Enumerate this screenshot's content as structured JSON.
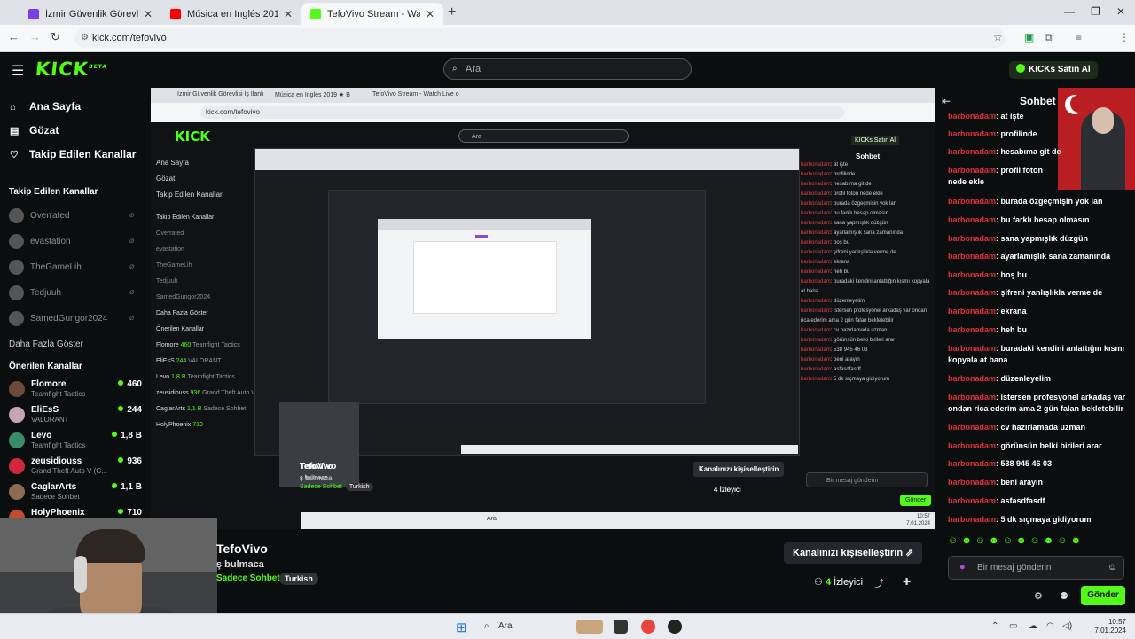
{
  "browser": {
    "tabs": [
      {
        "title": "İzmir Güvenlik Görevlisi İş İlanlı",
        "favicon_color": "#7b3fe4"
      },
      {
        "title": "Música en Inglés 2019 ★ B",
        "favicon_color": "#ff0000"
      },
      {
        "title": "TefoVivo Stream - Watch Live o",
        "favicon_color": "#53fc18"
      }
    ],
    "new_tab": "+",
    "url": "kick.com/tefovivo"
  },
  "header": {
    "logo": "KICK",
    "logo_tag": "BETA",
    "search_placeholder": "Ara",
    "buy_kicks": "KICKs Satın Al"
  },
  "sidebar": {
    "nav": [
      {
        "label": "Ana Sayfa",
        "icon": "home-icon"
      },
      {
        "label": "Gözat",
        "icon": "browse-icon"
      },
      {
        "label": "Takip Edilen Kanallar",
        "icon": "heart-icon"
      }
    ],
    "followed_heading": "Takip Edilen Kanallar",
    "followed": [
      "Overrated",
      "evastation",
      "TheGameLih",
      "Tedjuuh",
      "SamedGungor2024"
    ],
    "show_more": "Daha Fazla Göster",
    "recommended_heading": "Önerilen Kanallar",
    "recommended": [
      {
        "name": "Flomore",
        "game": "Teamfight Tactics",
        "viewers": "460",
        "color": "#6b4a3a"
      },
      {
        "name": "EliEsS",
        "game": "VALORANT",
        "viewers": "244",
        "color": "#c7a3b5"
      },
      {
        "name": "Levo",
        "game": "Teamfight Tactics",
        "viewers": "1,8 B",
        "color": "#3a8a6b"
      },
      {
        "name": "zeusidiouss",
        "game": "Grand Theft Auto V (G...",
        "viewers": "936",
        "color": "#d0283a"
      },
      {
        "name": "CaglarArts",
        "game": "Sadece Sohbet",
        "viewers": "1,1 B",
        "color": "#8d6b52"
      },
      {
        "name": "HolyPhoenix",
        "game": "",
        "viewers": "710",
        "color": "#c14d2a"
      }
    ]
  },
  "nested": {
    "url": "kick.com/tefovivo",
    "tab1": "İzmir Güvenlik Görevlisi İş İlanlı",
    "tab2": "Música en Inglés 2019 ★ B",
    "tab3": "TefoVivo Stream - Watch Live o",
    "search": "Ara",
    "logo": "KICK",
    "nav1": "Ana Sayfa",
    "nav2": "Gözat",
    "nav3": "Takip Edilen Kanallar",
    "followed_heading": "Takip Edilen Kanallar",
    "followed": [
      "Overrated",
      "evastation",
      "TheGameLih",
      "Tedjuuh",
      "SamedGungor2024"
    ],
    "show_more": "Daha Fazla Göster",
    "recommended_heading": "Önerilen Kanallar",
    "recommended": [
      {
        "name": "Flomore",
        "game": "Teamfight Tactics",
        "viewers": "460"
      },
      {
        "name": "EliEsS",
        "game": "VALORANT",
        "viewers": "244"
      },
      {
        "name": "Levo",
        "game": "Teamfight Tactics",
        "viewers": "1,8 B"
      },
      {
        "name": "zeusidiouss",
        "game": "Grand Theft Auto V (G...",
        "viewers": "936"
      },
      {
        "name": "CaglarArts",
        "game": "Sadece Sohbet",
        "viewers": "1,1 B"
      },
      {
        "name": "HolyPhoenix",
        "game": "",
        "viewers": "710"
      }
    ],
    "chat_title": "Sohbet",
    "buy_kicks": "KICKs Satın Al",
    "streamer": "TefoVivo",
    "title": "ş bulmaca",
    "category": "Sadece Sohbet",
    "language": "Turkish",
    "customize": "Kanalınızı kişiselleştirin",
    "viewers": "4 İzleyici",
    "chat_placeholder": "Bir mesaj gönderin",
    "send": "Gönder",
    "clock_time": "10:57",
    "clock_date": "7.01.2024"
  },
  "stream_info": {
    "streamer": "TefoVivo",
    "title": "ş bulmaca",
    "category": "Sadece Sohbet",
    "language": "Turkish",
    "customize": "Kanalınızı kişiselleştirin",
    "viewers_count": "4",
    "viewers_label": "İzleyici"
  },
  "chat": {
    "title": "Sohbet",
    "username": "barbonadam",
    "messages": [
      "at işte",
      "profilinde",
      "hesabıma git de",
      "profil foton nede ekle",
      "burada özgeçmişin yok lan",
      "bu farklı hesap olmasın",
      "sana yapmışlık düzgün",
      "ayarlamışlık sana zamanında",
      "boş bu",
      "şifreni yanlışlıkla verme de",
      "ekrana",
      "heh bu",
      "buradaki kendini anlattığın kısmı kopyala at bana",
      "düzenleyelim",
      "istersen profesyonel arkadaş var ondan rica ederim ama 2 gün falan bekletebilir",
      "cv hazırlamada uzman",
      "görünsün belki birileri arar",
      "538 945 46 03",
      "beni arayın",
      "asfasdfasdf",
      "5 dk sıçmaya gidiyorum"
    ],
    "input_placeholder": "Bir mesaj gönderin",
    "send_label": "Gönder"
  },
  "taskbar": {
    "search": "Ara",
    "time": "10:57",
    "date": "7.01.2024"
  },
  "colors": {
    "accent": "#53fc18",
    "username": "#e1313b",
    "background": "#0b0e0f"
  }
}
